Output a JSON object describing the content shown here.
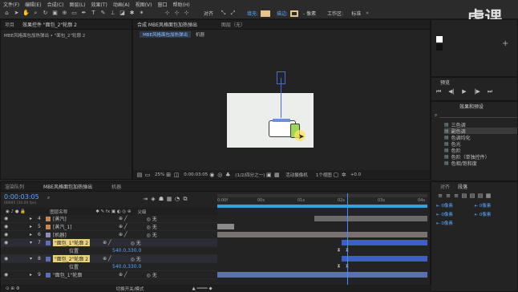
{
  "menu": [
    "文件(F)",
    "编辑(E)",
    "合成(C)",
    "图层(L)",
    "效果(T)",
    "动画(A)",
    "视图(V)",
    "窗口",
    "帮助(H)"
  ],
  "toolbar": {
    "align_label": "对齐",
    "fill_label": "填充:",
    "stroke_label": "描边:",
    "stroke_value": "- 像素",
    "workspace_label": "工作区:",
    "workspace_value": "标准",
    "search_placeholder": "搜索帮助"
  },
  "watermark": "虎课网",
  "project_panel": {
    "tab_label": "项目",
    "effects_tab": "效果控件 \"面包_2\"轮廓 2",
    "breadcrumb": "MBE风格面包加热弹出 • \"面包_2\"轮廓 2"
  },
  "comp_panel": {
    "tab_label": "合成 MBE风格面包加热弹出",
    "layer_tab": "图层（无）",
    "flow_tab": "MBE风格面包加热弹出",
    "robot_tab": "机器",
    "zoom": "25%",
    "timecode": "0:00:03:05",
    "resolution": "(1/2/四分之一)",
    "camera": "活动摄像机",
    "views": "1个视图",
    "offset": "+0.0"
  },
  "preview_panel": {
    "tab_label": "预览",
    "controls": [
      "⏮",
      "◀|",
      "▶",
      "|▶",
      "⏭"
    ]
  },
  "effects_panel": {
    "tab_label": "效果和预设",
    "search_placeholder": "",
    "items": [
      "三色调",
      "副色调",
      "色调均化",
      "色光",
      "色阶",
      "色阶（单独控件）",
      "色相/饱和度"
    ],
    "selected_index": 1
  },
  "paragraph_panel": {
    "tab_label": "段落",
    "align_tab": "对齐",
    "fields": [
      "0像素",
      "0像素",
      "0像素",
      "0像素",
      "0像素"
    ]
  },
  "timeline_panel": {
    "tabs": [
      "渲染队列",
      "MBE风格面包加热弹出",
      "机器"
    ],
    "timecode": "0:00:03:05",
    "timecode_sub": "00095 (30.00 fps)",
    "col_layer_name": "图层名称",
    "col_parent": "父级",
    "ruler_labels": [
      "0:00f",
      "00s",
      "01s",
      "02s",
      "03s",
      "04s"
    ],
    "footer_label": "切换开关/模式",
    "layers": [
      {
        "num": "4",
        "name": "[蒸汽]",
        "color": "#c98552",
        "parent": "无",
        "expand": "▸"
      },
      {
        "num": "5",
        "name": "[蒸汽_1]",
        "color": "#c98552",
        "parent": "无",
        "expand": "▸"
      },
      {
        "num": "6",
        "name": "[机器]",
        "color": "#8c8cb4",
        "parent": "无",
        "expand": "▸"
      },
      {
        "num": "7",
        "name": "\"面包_1\"轮廓 2",
        "color": "#5a6fb4",
        "parent": "无",
        "expand": "▾",
        "selected": true
      },
      {
        "num": "",
        "name": "位置",
        "color": "",
        "parent": "",
        "value": "540.0,330.0",
        "sub": true
      },
      {
        "num": "8",
        "name": "\"面包_2\"轮廓 2",
        "color": "#5a6fb4",
        "parent": "无",
        "expand": "▾",
        "selected": true
      },
      {
        "num": "",
        "name": "位置",
        "color": "",
        "parent": "",
        "value": "540.0,330.0",
        "sub": true
      },
      {
        "num": "9",
        "name": "\"面包_1\"轮廓",
        "color": "#5a6fb4",
        "parent": "无",
        "expand": "▸"
      }
    ],
    "bars": [
      {
        "start": 0.46,
        "end": 1.0,
        "color": "#6a6a6a"
      },
      {
        "start": 0.0,
        "end": 0.08,
        "color": "#8a8a8a"
      },
      {
        "start": 0.0,
        "end": 1.0,
        "color": "#7a7272"
      },
      {
        "start": 0.59,
        "end": 1.0,
        "color": "#3e5ec8"
      },
      null,
      {
        "start": 0.59,
        "end": 1.0,
        "color": "#3e5ec8"
      },
      null,
      {
        "start": 0.0,
        "end": 1.0,
        "color": "#5a6fb4"
      }
    ],
    "playhead": 0.62
  },
  "colors": {
    "accent": "#4a8bff",
    "work_area": "#3aa0d8"
  }
}
